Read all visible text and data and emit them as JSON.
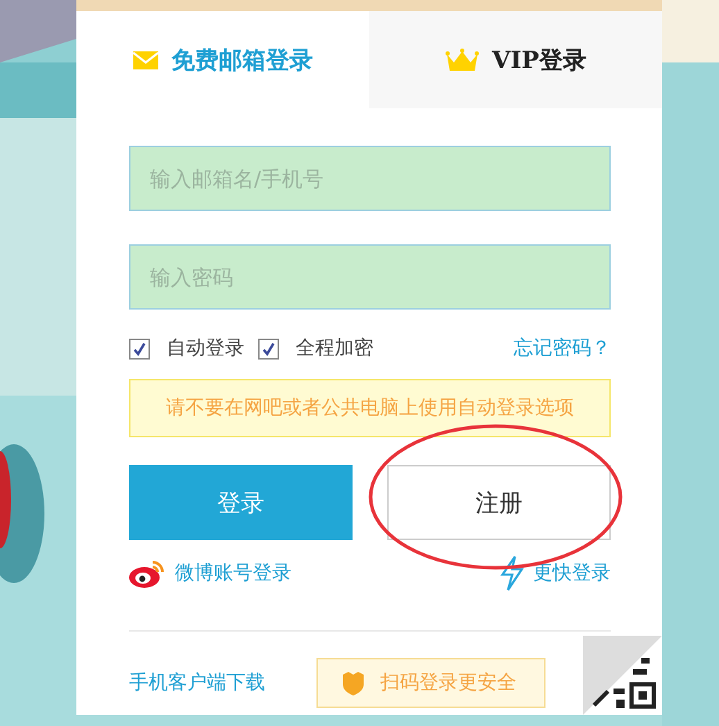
{
  "tabs": [
    {
      "label": "免费邮箱登录",
      "selected": true
    },
    {
      "label": "VIP登录",
      "selected": false
    }
  ],
  "fields": [
    {
      "placeholder": "输入邮箱名/手机号"
    },
    {
      "placeholder": "输入密码"
    }
  ],
  "options": [
    {
      "label": "自动登录",
      "checked": true
    },
    {
      "label": "全程加密",
      "checked": true
    }
  ],
  "forgot_link": "忘记密码？",
  "warning": "请不要在网吧或者公共电脑上使用自动登录选项",
  "buttons": [
    {
      "label": "登录",
      "kind": "primary"
    },
    {
      "label": "注册",
      "kind": "secondary"
    }
  ],
  "alt_logins": [
    {
      "label": "微博账号登录"
    },
    {
      "label": "更快登录"
    }
  ],
  "download_link": "手机客户端下载",
  "qr_tip": "扫码登录更安全"
}
